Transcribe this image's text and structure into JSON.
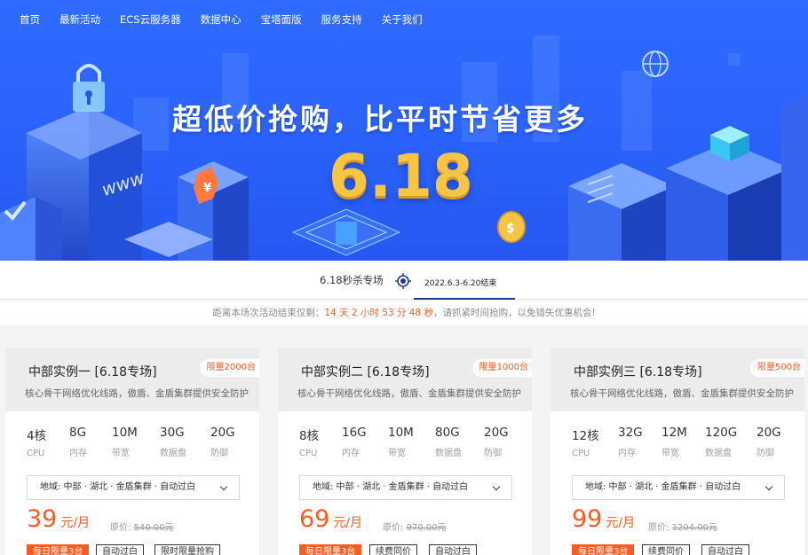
{
  "nav": {
    "items": [
      "首页",
      "最新活动",
      "ECS云服务器",
      "数据中心",
      "宝塔面版",
      "服务支持",
      "关于我们"
    ]
  },
  "hero": {
    "title": "超低价抢购，比平时节省更多",
    "big": "6.18",
    "www": "www"
  },
  "tabs": {
    "label": "6.18秒杀专场",
    "active_date": "2022.6.3-6.20结束"
  },
  "countdown": {
    "prefix": "距离本场次活动结束仅剩：",
    "time": "14 天 2 小时 53 分 48 秒",
    "suffix": "，请抓紧时间抢购，以免错失优惠机会!"
  },
  "colors": {
    "accent": "#ff5a1f",
    "hero": "#2a64fb",
    "gold": "#f6c544",
    "tab_underline": "#1b3a8c"
  },
  "cards": [
    {
      "title": "中部实例一 [6.18专场]",
      "badge": "限量2000台",
      "desc": "核心骨干网络优化线路，傲盾、金盾集群提供安全防护",
      "specs": [
        {
          "value": "4核",
          "label": "CPU"
        },
        {
          "value": "8G",
          "label": "内存"
        },
        {
          "value": "10M",
          "label": "带宽"
        },
        {
          "value": "30G",
          "label": "数据盘"
        },
        {
          "value": "20G",
          "label": "防御"
        }
      ],
      "region": "地域:  中部 · 湖北 · 金盾集群 · 自动过白",
      "price": "39",
      "unit": "元/月",
      "orig_label": "原价:",
      "orig_value": "540.00元",
      "tags": [
        "每日限量3台",
        "自动过白",
        "限时限量抢购"
      ]
    },
    {
      "title": "中部实例二 [6.18专场]",
      "badge": "限量1000台",
      "desc": "核心骨干网络优化线路，傲盾、金盾集群提供安全防护",
      "specs": [
        {
          "value": "8核",
          "label": "CPU"
        },
        {
          "value": "16G",
          "label": "内存"
        },
        {
          "value": "10M",
          "label": "带宽"
        },
        {
          "value": "80G",
          "label": "数据盘"
        },
        {
          "value": "20G",
          "label": "防御"
        }
      ],
      "region": "地域:  中部 · 湖北 · 金盾集群 · 自动过白",
      "price": "69",
      "unit": "元/月",
      "orig_label": "原价:",
      "orig_value": "970.00元",
      "tags": [
        "每日限量3台",
        "续费同价",
        "自动过白"
      ]
    },
    {
      "title": "中部实例三 [6.18专场]",
      "badge": "限量500台",
      "desc": "核心骨干网络优化线路，傲盾、金盾集群提供安全防护",
      "specs": [
        {
          "value": "12核",
          "label": "CPU"
        },
        {
          "value": "32G",
          "label": "内存"
        },
        {
          "value": "12M",
          "label": "带宽"
        },
        {
          "value": "120G",
          "label": "数据盘"
        },
        {
          "value": "20G",
          "label": "防御"
        }
      ],
      "region": "地域:  中部 · 湖北 · 金盾集群 · 自动过白",
      "price": "99",
      "unit": "元/月",
      "orig_label": "原价:",
      "orig_value": "1204.00元",
      "tags": [
        "每日限量3台",
        "续费同价",
        "自动过白"
      ]
    }
  ]
}
